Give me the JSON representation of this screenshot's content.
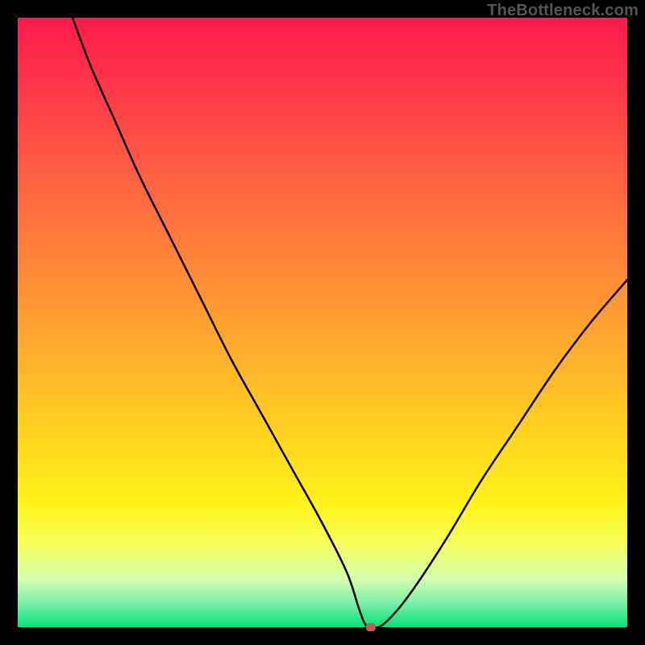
{
  "watermark": "TheBottleneck.com",
  "chart_data": {
    "type": "line",
    "title": "",
    "xlabel": "",
    "ylabel": "",
    "xlim": [
      0,
      100
    ],
    "ylim": [
      0,
      100
    ],
    "grid": false,
    "legend": false,
    "series": [
      {
        "name": "bottleneck-curve",
        "x": [
          9,
          12,
          16,
          20,
          25,
          30,
          35,
          40,
          45,
          50,
          54,
          56,
          57,
          58,
          60,
          64,
          70,
          76,
          82,
          88,
          94,
          100
        ],
        "y": [
          100,
          92,
          83,
          74,
          64,
          54,
          44,
          35,
          26,
          17,
          9,
          3,
          0.5,
          0,
          0.5,
          5,
          14,
          24,
          33,
          42,
          50,
          57
        ]
      }
    ],
    "marker": {
      "x": 58,
      "y": 0,
      "color": "#c9564f"
    },
    "gradient_stops": [
      {
        "pos": 0,
        "color": "#ff1a4b"
      },
      {
        "pos": 100,
        "color": "#00e47a"
      }
    ]
  }
}
